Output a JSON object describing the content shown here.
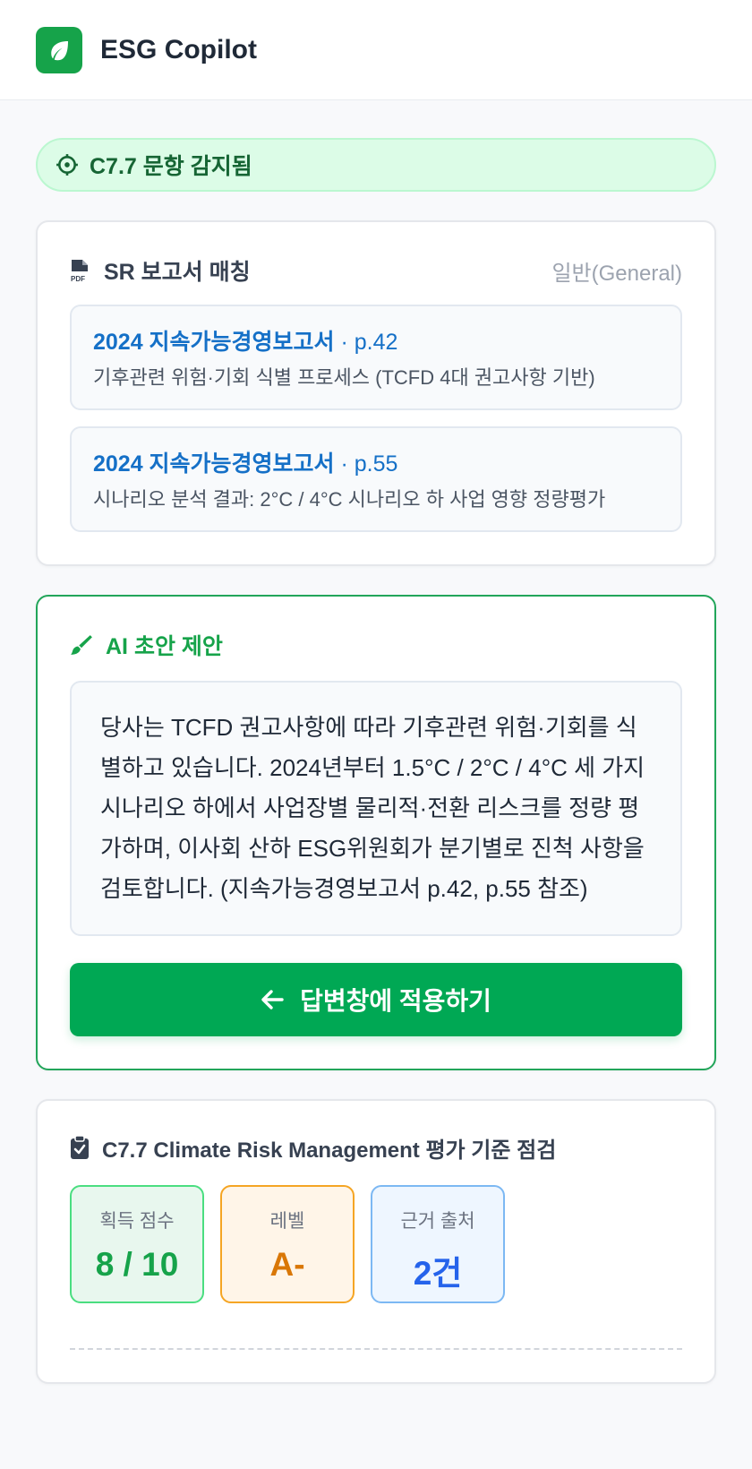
{
  "header": {
    "app_title": "ESG Copilot",
    "logo_icon": "leaf-icon",
    "brand_color": "#16a34a"
  },
  "detect_banner": {
    "text": "C7.7 문항 감지됨",
    "icon": "target-icon"
  },
  "sr_match": {
    "title": "SR 보고서 매칭",
    "tag": "일반(General)",
    "icon": "pdf-file-icon",
    "items": [
      {
        "doc": "2024 지속가능경영보고서",
        "page": " · p.42",
        "desc": "기후관련 위험·기회 식별 프로세스 (TCFD 4대 권고사항 기반)"
      },
      {
        "doc": "2024 지속가능경영보고서",
        "page": " · p.55",
        "desc": "시나리오 분석 결과: 2°C / 4°C 시나리오 하 사업 영향 정량평가"
      }
    ]
  },
  "ai_draft": {
    "title": "AI 초안 제안",
    "icon": "paintbrush-icon",
    "text": "당사는 TCFD 권고사항에 따라 기후관련 위험·기회를 식별하고 있습니다. 2024년부터 1.5°C / 2°C / 4°C 세 가지 시나리오 하에서 사업장별 물리적·전환 리스크를 정량 평가하며, 이사회 산하 ESG위원회가 분기별로 진척 사항을 검토합니다. (지속가능경영보고서 p.42, p.55 참조)",
    "apply_label": "답변창에 적용하기",
    "apply_icon": "arrow-left-icon"
  },
  "evaluation": {
    "title": "C7.7 Climate Risk Management  평가 기준 점검",
    "icon": "clipboard-check-icon",
    "metrics": [
      {
        "label": "획득 점수",
        "value": "8 / 10",
        "color": "#16a34a"
      },
      {
        "label": "레벨",
        "value": "A-",
        "color": "#d97706"
      },
      {
        "label": "근거 출처",
        "value": "2건",
        "color": "#2563eb"
      }
    ]
  }
}
